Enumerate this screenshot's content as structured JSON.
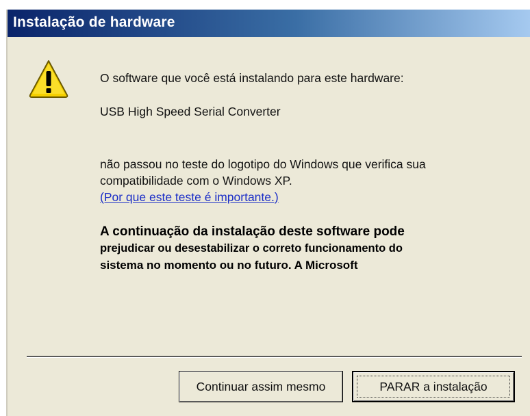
{
  "window": {
    "title": "Instalação de hardware"
  },
  "icon": {
    "name": "warning-icon",
    "color": "#f5d000"
  },
  "message": {
    "intro": "O software que você está instalando para este hardware:",
    "device": "USB High Speed Serial Converter",
    "logo_line1": "não passou no teste do logotipo do Windows que verifica sua",
    "logo_line2": "compatibilidade com o Windows XP.",
    "link": "(Por que este teste é importante.)",
    "warning_line1": "A continuação da instalação deste software pode",
    "warning_line2": "prejudicar ou desestabilizar o correto funcionamento do",
    "warning_line3": "sistema no momento ou no futuro. A Microsoft"
  },
  "buttons": {
    "continue_label": "Continuar assim mesmo",
    "stop_label": "PARAR a instalação"
  },
  "colors": {
    "titlebar_start": "#0a246a",
    "titlebar_end": "#a6caf0",
    "dialog_bg": "#ece9d8",
    "link": "#1a2dc7"
  }
}
